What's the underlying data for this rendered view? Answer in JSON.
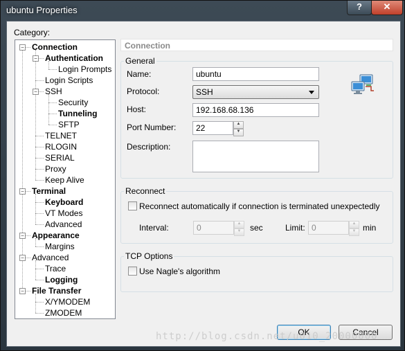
{
  "window": {
    "title": "ubuntu Properties",
    "help_label": "?",
    "close_label": "✕"
  },
  "category_label": "Category:",
  "tree": [
    {
      "label": "Connection",
      "bold": true,
      "expander": "minus"
    },
    {
      "label": "Authentication",
      "bold": true,
      "expander": "minus"
    },
    {
      "label": "Login Prompts",
      "bold": false
    },
    {
      "label": "Login Scripts",
      "bold": false
    },
    {
      "label": "SSH",
      "bold": false,
      "expander": "minus"
    },
    {
      "label": "Security",
      "bold": false
    },
    {
      "label": "Tunneling",
      "bold": true
    },
    {
      "label": "SFTP",
      "bold": false
    },
    {
      "label": "TELNET",
      "bold": false
    },
    {
      "label": "RLOGIN",
      "bold": false
    },
    {
      "label": "SERIAL",
      "bold": false
    },
    {
      "label": "Proxy",
      "bold": false
    },
    {
      "label": "Keep Alive",
      "bold": false
    },
    {
      "label": "Terminal",
      "bold": true,
      "expander": "minus"
    },
    {
      "label": "Keyboard",
      "bold": true
    },
    {
      "label": "VT Modes",
      "bold": false
    },
    {
      "label": "Advanced",
      "bold": false
    },
    {
      "label": "Appearance",
      "bold": true,
      "expander": "minus"
    },
    {
      "label": "Margins",
      "bold": false
    },
    {
      "label": "Advanced",
      "bold": false,
      "expander": "minus"
    },
    {
      "label": "Trace",
      "bold": false
    },
    {
      "label": "Logging",
      "bold": true
    },
    {
      "label": "File Transfer",
      "bold": true,
      "expander": "minus"
    },
    {
      "label": "X/YMODEM",
      "bold": false
    },
    {
      "label": "ZMODEM",
      "bold": false
    }
  ],
  "panel_title": "Connection",
  "general": {
    "label": "General",
    "name_label": "Name:",
    "name_value": "ubuntu",
    "protocol_label": "Protocol:",
    "protocol_value": "SSH",
    "host_label": "Host:",
    "host_value": "192.168.68.136",
    "port_label": "Port Number:",
    "port_value": "22",
    "description_label": "Description:",
    "description_value": ""
  },
  "reconnect": {
    "label": "Reconnect",
    "checkbox_label": "Reconnect automatically if connection is terminated unexpectedly",
    "checked": false,
    "interval_label": "Interval:",
    "interval_value": "0",
    "interval_unit": "sec",
    "limit_label": "Limit:",
    "limit_value": "0",
    "limit_unit": "min"
  },
  "tcp": {
    "label": "TCP Options",
    "nagle_label": "Use Nagle's algorithm",
    "checked": false
  },
  "buttons": {
    "ok": "OK",
    "cancel": "Cancel"
  },
  "watermark": "http://blog.csdn.net/u010_20000000",
  "colors": {
    "title_bar": "#2a353e",
    "close_button": "#c0402b",
    "dialog_bg": "#f0f0f0"
  }
}
